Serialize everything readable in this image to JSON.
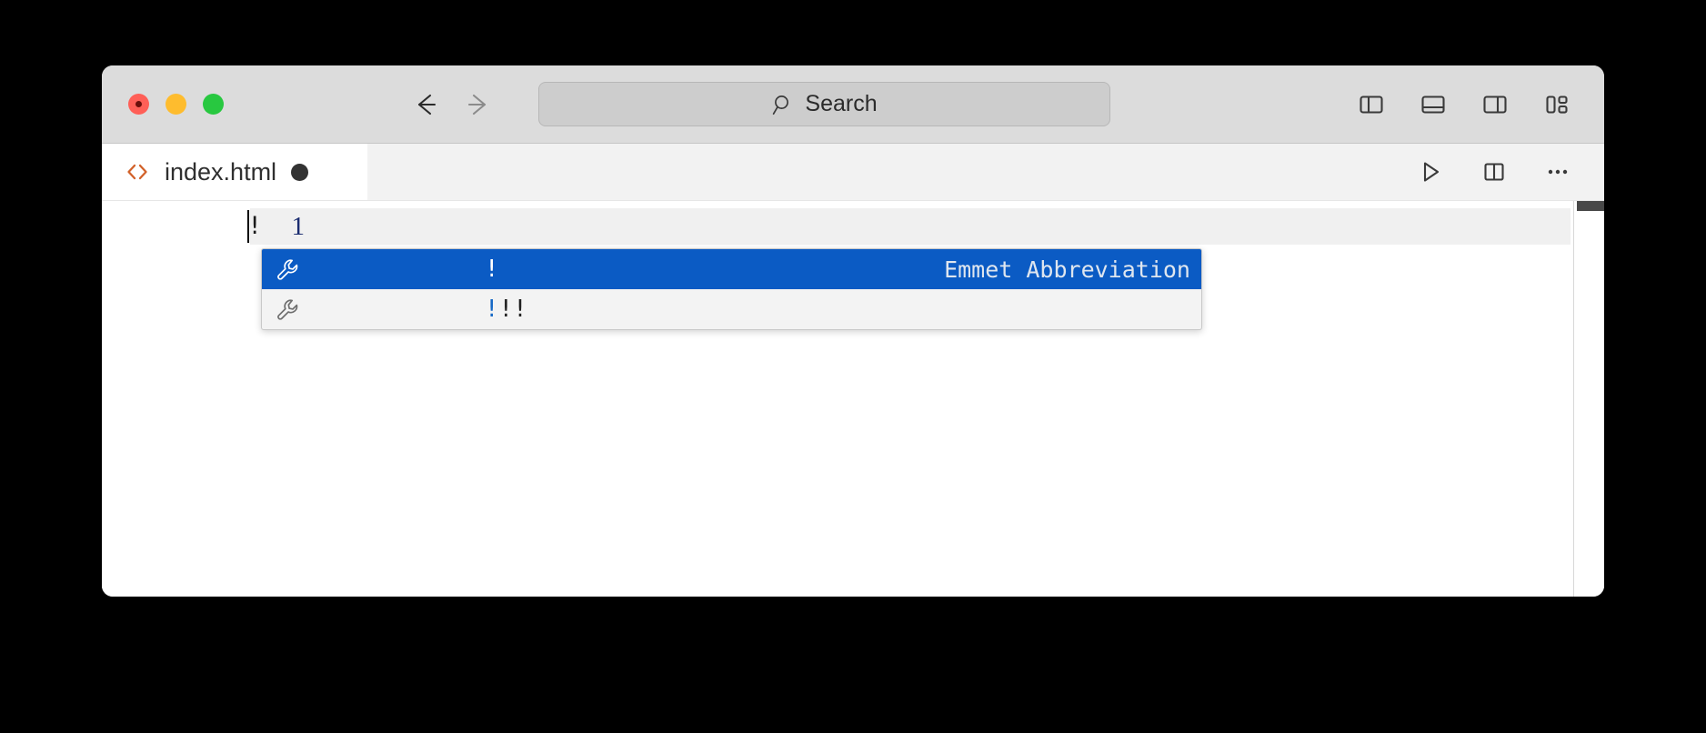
{
  "window": {
    "traffic_lights": [
      {
        "name": "close",
        "color": "#ff5f57"
      },
      {
        "name": "minimize",
        "color": "#febc2e"
      },
      {
        "name": "maximize",
        "color": "#28c840"
      }
    ]
  },
  "titlebar": {
    "back_icon": "arrow-left-icon",
    "forward_icon": "arrow-right-icon",
    "search": {
      "placeholder": "Search",
      "icon": "search-icon"
    },
    "layout_buttons": [
      {
        "name": "toggle-primary-sidebar",
        "icon": "layout-sidebar-left-icon"
      },
      {
        "name": "toggle-panel",
        "icon": "layout-panel-bottom-icon"
      },
      {
        "name": "toggle-secondary-sidebar",
        "icon": "layout-sidebar-right-icon"
      },
      {
        "name": "customize-layout",
        "icon": "layout-customize-icon"
      }
    ]
  },
  "tabbar": {
    "tab": {
      "icon": "html-file-icon",
      "label": "index.html",
      "dirty": true,
      "dirty_icon": "dirty-dot-icon"
    },
    "actions": [
      {
        "name": "run-button",
        "icon": "play-icon"
      },
      {
        "name": "split-editor-button",
        "icon": "split-editor-icon"
      },
      {
        "name": "more-actions-button",
        "icon": "ellipsis-icon"
      }
    ]
  },
  "editor": {
    "line_number": "1",
    "line_text": "!",
    "language": "html"
  },
  "suggest": {
    "items": [
      {
        "icon": "wrench-icon",
        "matched": "!",
        "rest": "",
        "detail": "Emmet Abbreviation",
        "selected": true
      },
      {
        "icon": "wrench-icon",
        "matched": "!",
        "rest": "!!",
        "detail": "",
        "selected": false
      }
    ]
  },
  "colors": {
    "selection_blue": "#0b5bc4",
    "match_highlight": "#1869c6",
    "titlebar_bg": "#dcdcdc",
    "tabbar_bg": "#f2f2f2",
    "editor_bg": "#ffffff",
    "html_icon_orange": "#d2622a",
    "line_number": "#1a2c70"
  }
}
